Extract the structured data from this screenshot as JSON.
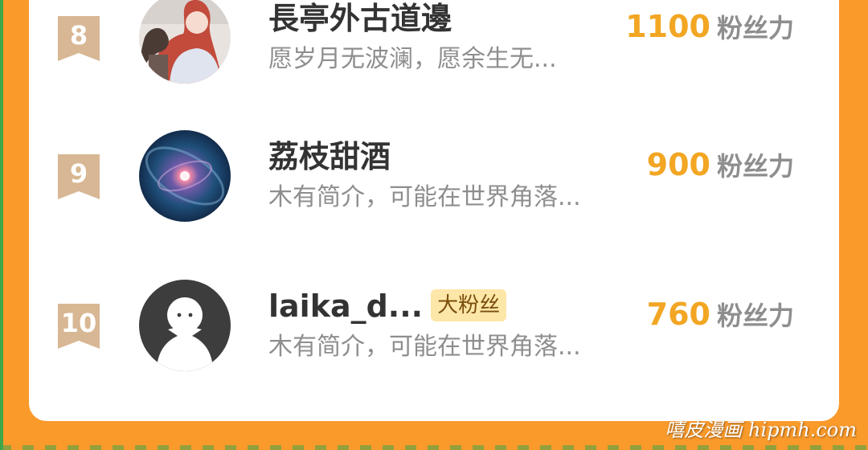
{
  "colors": {
    "background": "#f99a2b",
    "card": "#ffffff",
    "score": "#f2a623",
    "badge_fill": "#d8b794",
    "fan_tag_bg": "#fde7a8"
  },
  "rows": [
    {
      "rank": "8",
      "name": "長亭外古道邊",
      "tag": "",
      "desc": "愿岁月无波澜，愿余生无...",
      "score": "1100",
      "score_unit": "粉丝力",
      "avatar": "anime-couple-avatar"
    },
    {
      "rank": "9",
      "name": "荔枝甜酒",
      "tag": "",
      "desc": "木有简介，可能在世界角落...",
      "score": "900",
      "score_unit": "粉丝力",
      "avatar": "galaxy-avatar"
    },
    {
      "rank": "10",
      "name": "laika_d...",
      "tag": "大粉丝",
      "desc": "木有简介，可能在世界角落...",
      "score": "760",
      "score_unit": "粉丝力",
      "avatar": "default-user-avatar"
    }
  ],
  "watermark": "嘻皮漫画 hipmh.com"
}
